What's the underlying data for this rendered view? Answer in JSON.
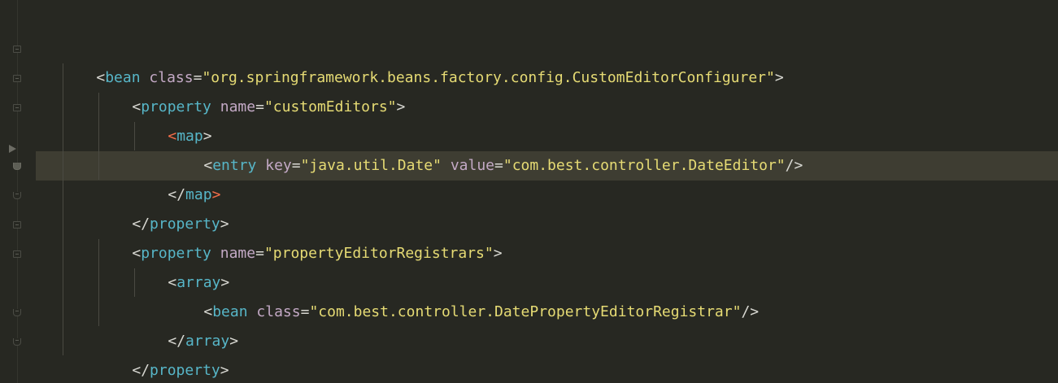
{
  "editor": {
    "language": "xml",
    "theme_colors": {
      "background": "#272822",
      "current_line": "#3e3d32",
      "tag": "#57b6c8",
      "highlighted_tag": "#f46d49",
      "attribute": "#c3a9c5",
      "string": "#e6db74",
      "punctuation": "#d8d8d2"
    },
    "lines": [
      {
        "open": "<",
        "tag": "bean",
        "a1_name": "class",
        "a1_eq": "=",
        "a1_val": "\"org.springframework.beans.factory.config.CustomEditorConfigurer\"",
        "close": ">"
      },
      {
        "open": "<",
        "tag": "property",
        "a1_name": "name",
        "a1_eq": "=",
        "a1_val": "\"customEditors\"",
        "close": ">"
      },
      {
        "open": "<",
        "tag": "map",
        "close": ">"
      },
      {
        "open": "<",
        "tag": "entry",
        "a1_name": "key",
        "a1_eq": "=",
        "a1_val": "\"java.util.Date\"",
        "a2_name": "value",
        "a2_eq": "=",
        "a2_val": "\"com.best.controller.DateEditor\"",
        "close": "/>"
      },
      {
        "open": "</",
        "tag": "map",
        "close": ">"
      },
      {
        "open": "</",
        "tag": "property",
        "close": ">"
      },
      {
        "open": "<",
        "tag": "property",
        "a1_name": "name",
        "a1_eq": "=",
        "a1_val": "\"propertyEditorRegistrars\"",
        "close": ">"
      },
      {
        "open": "<",
        "tag": "array",
        "close": ">"
      },
      {
        "open": "<",
        "tag": "bean",
        "a1_name": "class",
        "a1_eq": "=",
        "a1_val": "\"com.best.controller.DatePropertyEditorRegistrar\"",
        "close": "/>"
      },
      {
        "open": "</",
        "tag": "array",
        "close": ">"
      },
      {
        "open": "</",
        "tag": "property",
        "close": ">"
      }
    ]
  },
  "gutter": {
    "fold_icon": "fold-marker-icon",
    "caret_icon": "current-line-arrow-icon"
  }
}
